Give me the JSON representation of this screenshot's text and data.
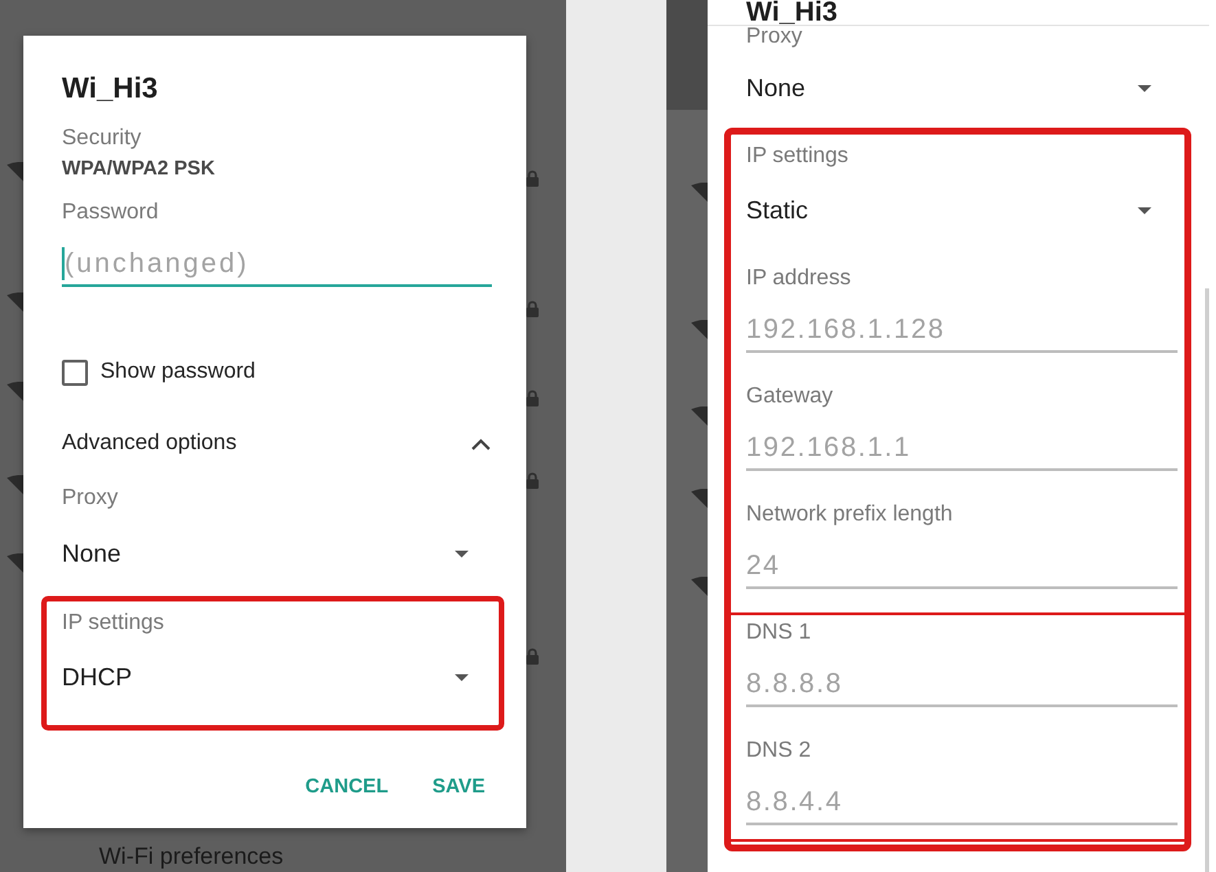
{
  "left_screen": {
    "dialog": {
      "title": "Wi_Hi3",
      "security": {
        "label": "Security",
        "value": "WPA/WPA2 PSK"
      },
      "password": {
        "label": "Password",
        "placeholder": "(unchanged)",
        "focused": true
      },
      "show_password": {
        "label": "Show password",
        "checked": false
      },
      "advanced_options": {
        "label": "Advanced options",
        "expanded": true
      },
      "proxy": {
        "label": "Proxy",
        "value": "None"
      },
      "ip_settings": {
        "label": "IP settings",
        "value": "DHCP",
        "highlighted": true
      },
      "buttons": [
        "CANCEL",
        "SAVE"
      ]
    },
    "list_item": "Wi-Fi preferences"
  },
  "right_screen": {
    "title": "Wi_Hi3",
    "proxy": {
      "label": "Proxy",
      "value": "None"
    },
    "static_settings": {
      "highlighted": true,
      "ip_settings": {
        "label": "IP settings",
        "value": "Static"
      },
      "field_groups": [
        {
          "fields": [
            {
              "label": "IP address",
              "placeholder": "192.168.1.128"
            },
            {
              "label": "Gateway",
              "placeholder": "192.168.1.1"
            },
            {
              "label": "Network prefix length",
              "placeholder": "24"
            }
          ]
        },
        {
          "fields": [
            {
              "label": "DNS 1",
              "placeholder": "8.8.8.8"
            },
            {
              "label": "DNS 2",
              "placeholder": "8.8.4.4"
            }
          ]
        }
      ]
    }
  }
}
